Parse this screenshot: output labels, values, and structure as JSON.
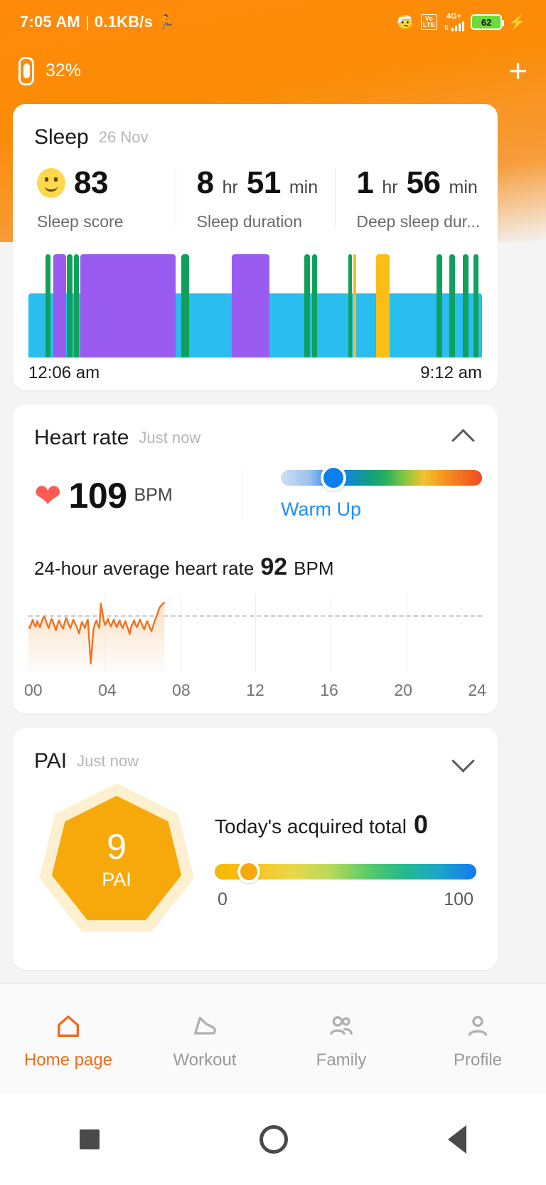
{
  "status_bar": {
    "time": "7:05 AM",
    "separator": "|",
    "network_speed": "0.1KB/s",
    "run_icon": "running-icon",
    "bluetooth_icon": "bluetooth-icon",
    "volte_top": "Vo",
    "volte_bottom": "LTE",
    "network_type": "4G+",
    "signal_icon": "signal-bars-icon",
    "battery_percent": "62",
    "charging_icon": "charging-bolt-icon"
  },
  "device_bar": {
    "band_icon": "smart-band-icon",
    "battery_label": "32%",
    "add_label": "+"
  },
  "sleep": {
    "title": "Sleep",
    "date": "26 Nov",
    "stats": [
      {
        "icon": "smiley-face-icon",
        "value": "83",
        "unit": "",
        "label": "Sleep score"
      },
      {
        "value_a": "8",
        "unit_a": "hr",
        "value_b": "51",
        "unit_b": "min",
        "label": "Sleep duration"
      },
      {
        "value_a": "1",
        "unit_a": "hr",
        "value_b": "56",
        "unit_b": "min",
        "label": "Deep sleep dur..."
      }
    ],
    "start_time": "12:06 am",
    "end_time": "9:12 am",
    "colors": {
      "light": "#29bdf0",
      "deep": "#9a5cf0",
      "rem": "#0fa15c",
      "awake": "#f9bf17"
    },
    "chart_data": {
      "type": "bar",
      "title": "Sleep stages",
      "xlabel": "",
      "ylabel": "",
      "categories": [
        "light",
        "deep",
        "rem",
        "awake"
      ],
      "segments": [
        {
          "stage": "light",
          "left": 0.0,
          "width": 1.0,
          "height": 0.62
        },
        {
          "stage": "rem",
          "left": 0.037,
          "width": 0.012,
          "height": 1.0
        },
        {
          "stage": "deep",
          "left": 0.055,
          "width": 0.028,
          "height": 1.0
        },
        {
          "stage": "rem",
          "left": 0.085,
          "width": 0.012,
          "height": 1.0
        },
        {
          "stage": "rem",
          "left": 0.101,
          "width": 0.01,
          "height": 1.0
        },
        {
          "stage": "deep",
          "left": 0.115,
          "width": 0.21,
          "height": 1.0
        },
        {
          "stage": "rem",
          "left": 0.337,
          "width": 0.018,
          "height": 1.0
        },
        {
          "stage": "deep",
          "left": 0.448,
          "width": 0.083,
          "height": 1.0
        },
        {
          "stage": "rem",
          "left": 0.608,
          "width": 0.012,
          "height": 1.0
        },
        {
          "stage": "rem",
          "left": 0.626,
          "width": 0.01,
          "height": 1.0
        },
        {
          "stage": "rem",
          "left": 0.705,
          "width": 0.008,
          "height": 1.0
        },
        {
          "stage": "awake",
          "left": 0.717,
          "width": 0.006,
          "height": 1.0
        },
        {
          "stage": "awake",
          "left": 0.766,
          "width": 0.03,
          "height": 1.0
        },
        {
          "stage": "rem",
          "left": 0.9,
          "width": 0.013,
          "height": 1.0
        },
        {
          "stage": "rem",
          "left": 0.928,
          "width": 0.013,
          "height": 1.0
        },
        {
          "stage": "rem",
          "left": 0.957,
          "width": 0.013,
          "height": 1.0
        },
        {
          "stage": "rem",
          "left": 0.981,
          "width": 0.011,
          "height": 1.0
        }
      ]
    }
  },
  "heart_rate": {
    "title": "Heart rate",
    "updated": "Just now",
    "collapse_icon": "chevron-up-icon",
    "heart_icon": "heart-icon",
    "value": "109",
    "unit": "BPM",
    "zone_label": "Warm Up",
    "zone_position_pct": 26,
    "avg_prefix": "24-hour average heart rate",
    "avg_value": "92",
    "avg_unit": "BPM",
    "chart_data": {
      "type": "line",
      "title": "24-hour heart rate",
      "xlabel": "",
      "ylabel": "BPM",
      "xlim": [
        0,
        24
      ],
      "ticks": [
        "00",
        "04",
        "08",
        "12",
        "16",
        "20",
        "24"
      ],
      "average_line": 92,
      "line_color": "#f2711c",
      "fill_color": "#fbe0c8",
      "data_end_hour": 7.2,
      "values": [
        88,
        86,
        92,
        97,
        90,
        88,
        95,
        91,
        87,
        93,
        99,
        101,
        96,
        90,
        86,
        92,
        98,
        94,
        88,
        83,
        90,
        96,
        92,
        88,
        85,
        93,
        99,
        95,
        90,
        86,
        91,
        97,
        93,
        89,
        84,
        79,
        88,
        94,
        90,
        86,
        92,
        97,
        70,
        40,
        62,
        85,
        92,
        96,
        90,
        86,
        118,
        108,
        96,
        90,
        94,
        98,
        92,
        88,
        93,
        97,
        91,
        87,
        92,
        96,
        90,
        86,
        91,
        95,
        89,
        84,
        78,
        88,
        92,
        96,
        90,
        87,
        92,
        97,
        93,
        88,
        84,
        90,
        95,
        91,
        86,
        82,
        88,
        94,
        99,
        104,
        110,
        114,
        116,
        118,
        120
      ]
    }
  },
  "pai": {
    "title": "PAI",
    "updated": "Just now",
    "expand_icon": "chevron-down-icon",
    "hex_value": "9",
    "hex_label": "PAI",
    "total_prefix": "Today's acquired total",
    "total_value": "0",
    "scale_min": "0",
    "scale_max": "100",
    "knob_position_pct": 13
  },
  "bottom_nav": {
    "items": [
      {
        "icon": "home-icon",
        "label": "Home page",
        "active": true
      },
      {
        "icon": "shoe-workout-icon",
        "label": "Workout",
        "active": false
      },
      {
        "icon": "family-people-icon",
        "label": "Family",
        "active": false
      },
      {
        "icon": "profile-person-icon",
        "label": "Profile",
        "active": false
      }
    ]
  },
  "system_nav": {
    "recents_icon": "square-recents-icon",
    "home_icon": "circle-home-icon",
    "back_icon": "triangle-back-icon"
  }
}
